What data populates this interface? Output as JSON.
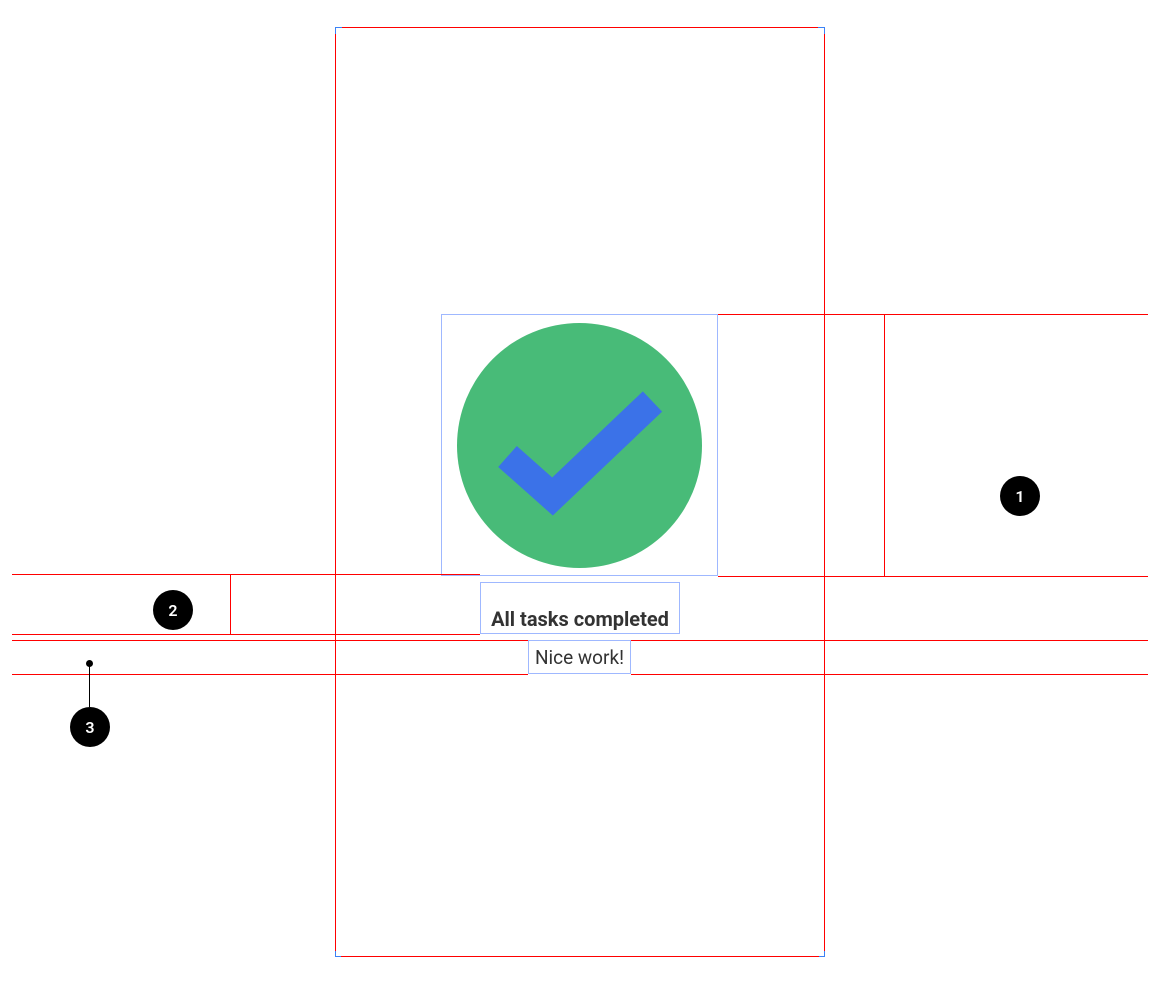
{
  "screen": {
    "title": "All tasks completed",
    "subtitle": "Nice work!",
    "icon": "checkmark-circle-icon",
    "icon_colors": {
      "circle": "#48bb78",
      "check": "#3b72e8"
    }
  },
  "callouts": [
    {
      "number": "1",
      "targets": "icon-frame"
    },
    {
      "number": "2",
      "targets": "title-frame"
    },
    {
      "number": "3",
      "targets": "subtitle-frame"
    }
  ]
}
